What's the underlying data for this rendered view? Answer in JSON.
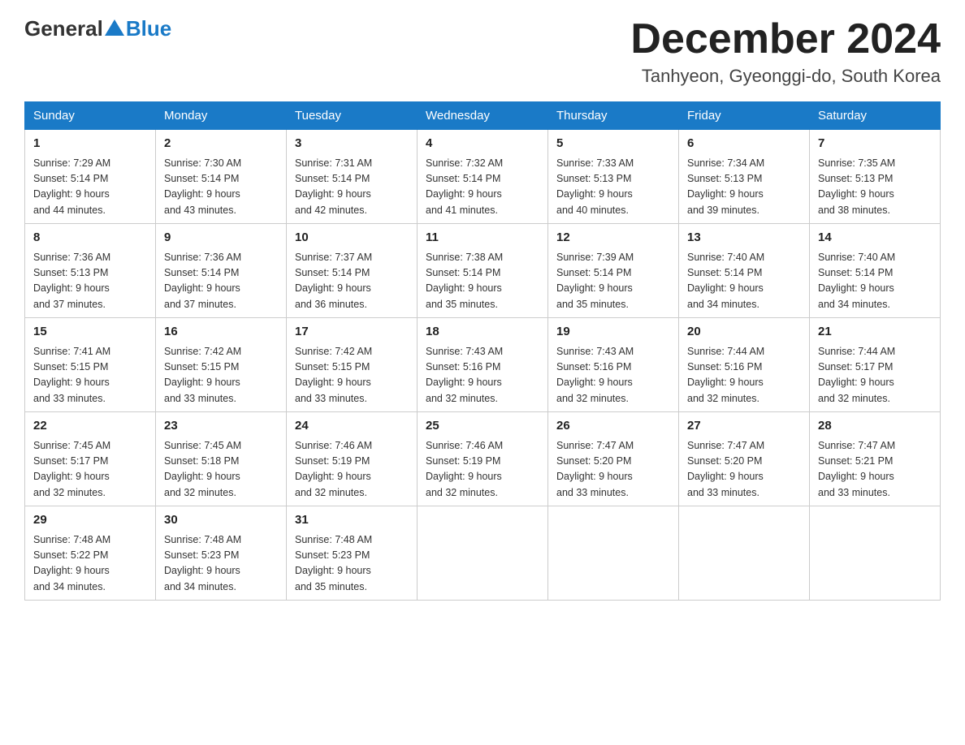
{
  "header": {
    "logo_general": "General",
    "logo_blue": "Blue",
    "month_title": "December 2024",
    "location": "Tanhyeon, Gyeonggi-do, South Korea"
  },
  "days_of_week": [
    "Sunday",
    "Monday",
    "Tuesday",
    "Wednesday",
    "Thursday",
    "Friday",
    "Saturday"
  ],
  "weeks": [
    [
      {
        "day": "1",
        "sunrise": "7:29 AM",
        "sunset": "5:14 PM",
        "daylight": "9 hours and 44 minutes."
      },
      {
        "day": "2",
        "sunrise": "7:30 AM",
        "sunset": "5:14 PM",
        "daylight": "9 hours and 43 minutes."
      },
      {
        "day": "3",
        "sunrise": "7:31 AM",
        "sunset": "5:14 PM",
        "daylight": "9 hours and 42 minutes."
      },
      {
        "day": "4",
        "sunrise": "7:32 AM",
        "sunset": "5:14 PM",
        "daylight": "9 hours and 41 minutes."
      },
      {
        "day": "5",
        "sunrise": "7:33 AM",
        "sunset": "5:13 PM",
        "daylight": "9 hours and 40 minutes."
      },
      {
        "day": "6",
        "sunrise": "7:34 AM",
        "sunset": "5:13 PM",
        "daylight": "9 hours and 39 minutes."
      },
      {
        "day": "7",
        "sunrise": "7:35 AM",
        "sunset": "5:13 PM",
        "daylight": "9 hours and 38 minutes."
      }
    ],
    [
      {
        "day": "8",
        "sunrise": "7:36 AM",
        "sunset": "5:13 PM",
        "daylight": "9 hours and 37 minutes."
      },
      {
        "day": "9",
        "sunrise": "7:36 AM",
        "sunset": "5:14 PM",
        "daylight": "9 hours and 37 minutes."
      },
      {
        "day": "10",
        "sunrise": "7:37 AM",
        "sunset": "5:14 PM",
        "daylight": "9 hours and 36 minutes."
      },
      {
        "day": "11",
        "sunrise": "7:38 AM",
        "sunset": "5:14 PM",
        "daylight": "9 hours and 35 minutes."
      },
      {
        "day": "12",
        "sunrise": "7:39 AM",
        "sunset": "5:14 PM",
        "daylight": "9 hours and 35 minutes."
      },
      {
        "day": "13",
        "sunrise": "7:40 AM",
        "sunset": "5:14 PM",
        "daylight": "9 hours and 34 minutes."
      },
      {
        "day": "14",
        "sunrise": "7:40 AM",
        "sunset": "5:14 PM",
        "daylight": "9 hours and 34 minutes."
      }
    ],
    [
      {
        "day": "15",
        "sunrise": "7:41 AM",
        "sunset": "5:15 PM",
        "daylight": "9 hours and 33 minutes."
      },
      {
        "day": "16",
        "sunrise": "7:42 AM",
        "sunset": "5:15 PM",
        "daylight": "9 hours and 33 minutes."
      },
      {
        "day": "17",
        "sunrise": "7:42 AM",
        "sunset": "5:15 PM",
        "daylight": "9 hours and 33 minutes."
      },
      {
        "day": "18",
        "sunrise": "7:43 AM",
        "sunset": "5:16 PM",
        "daylight": "9 hours and 32 minutes."
      },
      {
        "day": "19",
        "sunrise": "7:43 AM",
        "sunset": "5:16 PM",
        "daylight": "9 hours and 32 minutes."
      },
      {
        "day": "20",
        "sunrise": "7:44 AM",
        "sunset": "5:16 PM",
        "daylight": "9 hours and 32 minutes."
      },
      {
        "day": "21",
        "sunrise": "7:44 AM",
        "sunset": "5:17 PM",
        "daylight": "9 hours and 32 minutes."
      }
    ],
    [
      {
        "day": "22",
        "sunrise": "7:45 AM",
        "sunset": "5:17 PM",
        "daylight": "9 hours and 32 minutes."
      },
      {
        "day": "23",
        "sunrise": "7:45 AM",
        "sunset": "5:18 PM",
        "daylight": "9 hours and 32 minutes."
      },
      {
        "day": "24",
        "sunrise": "7:46 AM",
        "sunset": "5:19 PM",
        "daylight": "9 hours and 32 minutes."
      },
      {
        "day": "25",
        "sunrise": "7:46 AM",
        "sunset": "5:19 PM",
        "daylight": "9 hours and 32 minutes."
      },
      {
        "day": "26",
        "sunrise": "7:47 AM",
        "sunset": "5:20 PM",
        "daylight": "9 hours and 33 minutes."
      },
      {
        "day": "27",
        "sunrise": "7:47 AM",
        "sunset": "5:20 PM",
        "daylight": "9 hours and 33 minutes."
      },
      {
        "day": "28",
        "sunrise": "7:47 AM",
        "sunset": "5:21 PM",
        "daylight": "9 hours and 33 minutes."
      }
    ],
    [
      {
        "day": "29",
        "sunrise": "7:48 AM",
        "sunset": "5:22 PM",
        "daylight": "9 hours and 34 minutes."
      },
      {
        "day": "30",
        "sunrise": "7:48 AM",
        "sunset": "5:23 PM",
        "daylight": "9 hours and 34 minutes."
      },
      {
        "day": "31",
        "sunrise": "7:48 AM",
        "sunset": "5:23 PM",
        "daylight": "9 hours and 35 minutes."
      },
      null,
      null,
      null,
      null
    ]
  ],
  "labels": {
    "sunrise": "Sunrise:",
    "sunset": "Sunset:",
    "daylight": "Daylight:"
  }
}
